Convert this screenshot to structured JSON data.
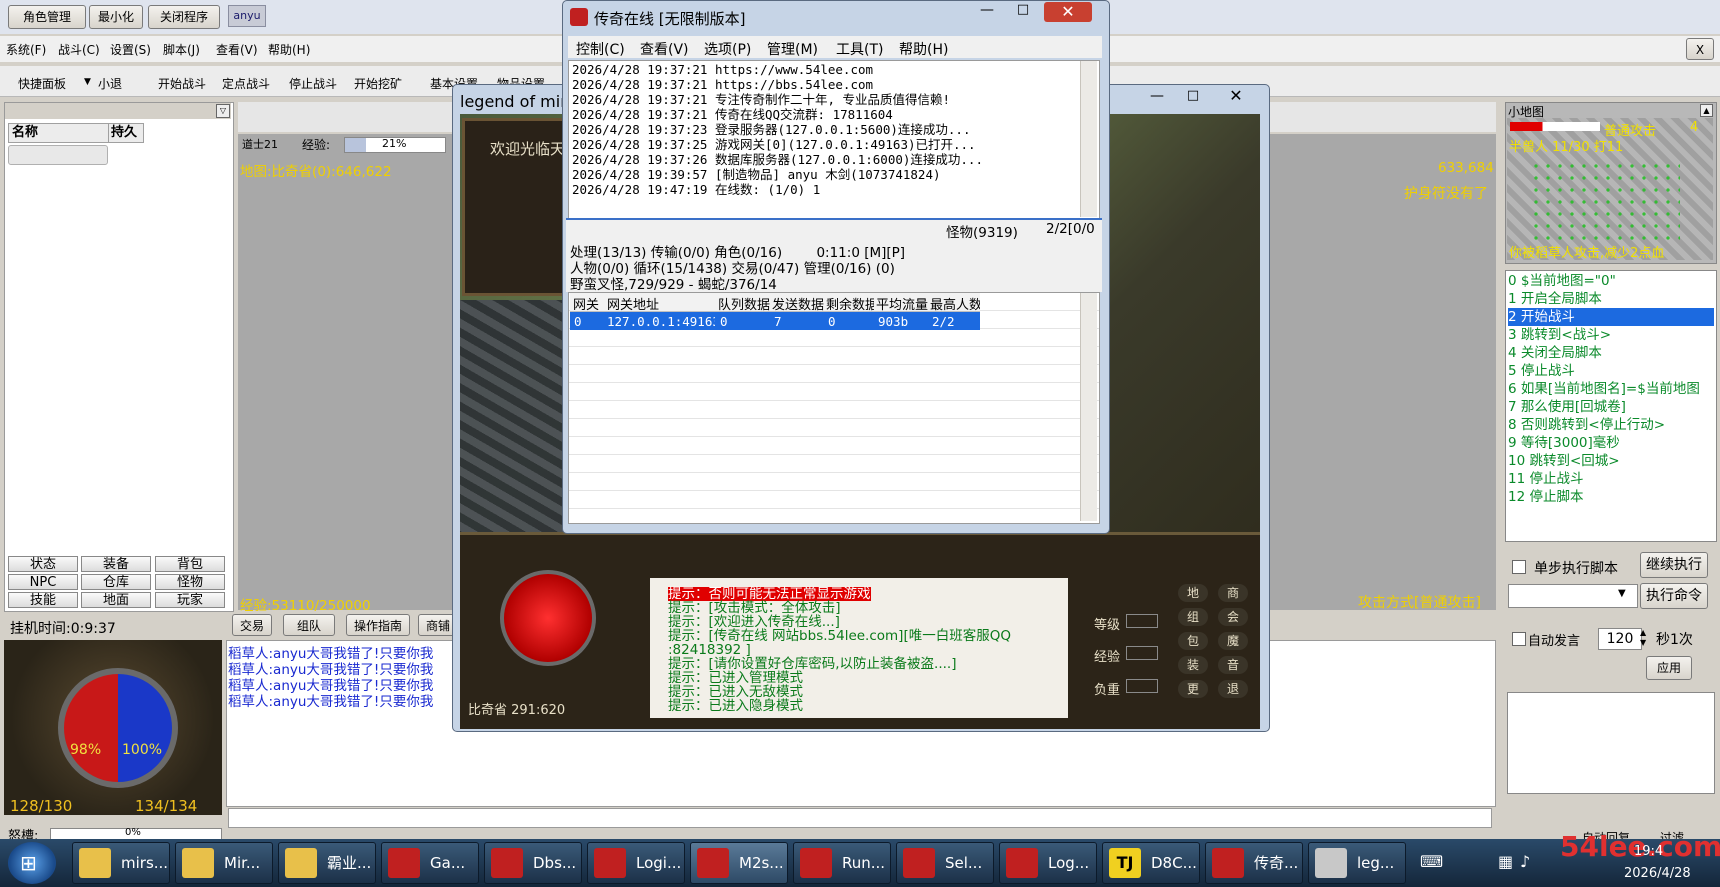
{
  "topbar": {
    "buttons": [
      "角色管理",
      "最小化",
      "关闭程序"
    ],
    "user_badge": "anyu"
  },
  "menubar": [
    "系统(F)",
    "战斗(C)",
    "设置(S)",
    "脚本(J)",
    "查看(V)",
    "帮助(H)"
  ],
  "close_x": "X",
  "toolbar": [
    "快捷面板",
    "小退",
    "开始战斗",
    "定点战斗",
    "停止战斗",
    "开始挖矿",
    "基本设置",
    "物品设置"
  ],
  "left_panel": {
    "col_name": "名称",
    "col_dur": "持久",
    "grid_buttons": [
      "状态",
      "装备",
      "背包",
      "NPC",
      "仓库",
      "怪物",
      "技能",
      "地面",
      "玩家"
    ],
    "hangtime": "挂机时间:0:9:37",
    "hp_pct": "98%",
    "mp_pct": "100%",
    "hp_val": "128/130",
    "mp_val": "134/134",
    "anger_label": "怒槽:",
    "anger_pct": "0%"
  },
  "center_map": {
    "class_label": "道士21",
    "exp_label": "经验:",
    "exp_pct": "21%",
    "map_info": "地图:比奇省(0):646,622",
    "coords_right": "633,684",
    "amulet_msg": "护身符没有了",
    "exp_total": "经验:53110/250000",
    "attack_mode": "攻击方式[普通攻击]"
  },
  "bottom_tabs": [
    "交易",
    "组队",
    "操作指南",
    "商铺"
  ],
  "chat_lines": [
    "稻草人:anyu大哥我错了!只要你我",
    "稻草人:anyu大哥我错了!只要你我",
    "稻草人:anyu大哥我错了!只要你我",
    "稻草人:anyu大哥我错了!只要你我"
  ],
  "minimap": {
    "title": "小地图",
    "attack_label": "普通攻击",
    "attack_num": "4",
    "monster_info": "半兽人 11/30 打11",
    "damage_msg": "你被稻草人攻击,减少2点血"
  },
  "script_lines": [
    "0 $当前地图=\"0\"",
    "1 开启全局脚本",
    "2 开始战斗",
    "3 跳转到<战斗>",
    "4 关闭全局脚本",
    "5 停止战斗",
    "6 如果[当前地图名]=$当前地图",
    "7 那么使用[回城卷]",
    "8 否则跳转到<停止行动>",
    "9 等待[3000]毫秒",
    "10 跳转到<回城>",
    "11 停止战斗",
    "12 停止脚本"
  ],
  "right_controls": {
    "single_step": "单步执行脚本",
    "continue": "继续执行",
    "exec_cmd": "执行命令",
    "auto_speak": "自动发言",
    "interval": "120",
    "per_sec": "秒1次",
    "apply": "应用",
    "bottom_tabs": [
      "自动回复",
      "过滤"
    ]
  },
  "game_window": {
    "title": "legend of mir2",
    "welcome": "欢迎光临天",
    "location": "比奇省 291:620",
    "messages": [
      "提示：否则可能无法正常显示游戏",
      "提示：[攻击模式：全体攻击]",
      "提示：[欢迎进入传奇在线...]",
      "提示：[传奇在线 网站bbs.54lee.com][唯一白班客服QQ",
      "  :82418392 ]",
      "提示：[请你设置好仓库密码,以防止装备被盗....]",
      "提示：已进入管理模式",
      "提示：已进入无敌模式",
      "提示：已进入隐身模式"
    ],
    "stat_labels": [
      "等级",
      "经验",
      "负重"
    ],
    "action_buttons": [
      "地",
      "商",
      "组",
      "会",
      "包",
      "魔",
      "装",
      "音",
      "更",
      "退"
    ]
  },
  "server_window": {
    "title": "传奇在线 [无限制版本]",
    "menu": [
      "控制(C)",
      "查看(V)",
      "选项(P)",
      "管理(M)",
      "工具(T)",
      "帮助(H)"
    ],
    "log_lines": [
      "2026/4/28 19:37:21 https://www.54lee.com",
      "2026/4/28 19:37:21 https://bbs.54lee.com",
      "2026/4/28 19:37:21 专注传奇制作二十年, 专业品质值得信赖!",
      "2026/4/28 19:37:21 传奇在线QQ交流群: 17811604",
      "2026/4/28 19:37:23 登录服务器(127.0.0.1:5600)连接成功...",
      "2026/4/28 19:37:25 游戏网关[0](127.0.0.1:49163)已打开...",
      "2026/4/28 19:37:26 数据库服务器(127.0.0.1:6000)连接成功...",
      "2026/4/28 19:39:57 [制造物品] anyu 木剑(1073741824)",
      "2026/4/28 19:47:19 在线数: (1/0) 1"
    ],
    "monster_stat": "怪物(9319)",
    "monster_ratio": "2/2[0/0",
    "stat_line1": "处理(13/13) 传输(0/0) 角色(0/16)        0:11:0 [M][P]",
    "stat_line2": "人物(0/0) 循环(15/1438) 交易(0/47) 管理(0/16) (0)",
    "stat_line3": "野蛮叉怪,729/929 - 蝎蛇/376/14",
    "table_headers": [
      "网关",
      "网关地址",
      "队列数据",
      "发送数据",
      "剩余数据",
      "平均流量",
      "最高人数"
    ],
    "table_row": [
      "0",
      "127.0.0.1:49163",
      "0",
      "7",
      "0",
      "903b",
      "2/2"
    ]
  },
  "taskbar": {
    "items": [
      "mirs...",
      "Mir...",
      "霸业...",
      "Ga...",
      "Dbs...",
      "Logi...",
      "M2s...",
      "Run...",
      "Sel...",
      "Log...",
      "D8C...",
      "传奇...",
      "leg..."
    ],
    "tj_logo": "TJ",
    "time": "19:4",
    "date": "2026/4/28",
    "watermark": "54lee.com"
  },
  "colors": {
    "selection": "#1c6ae0",
    "script_text": "#0a8a2a",
    "chat_text": "#1a2ad0",
    "game_yellow": "#f0c020"
  }
}
